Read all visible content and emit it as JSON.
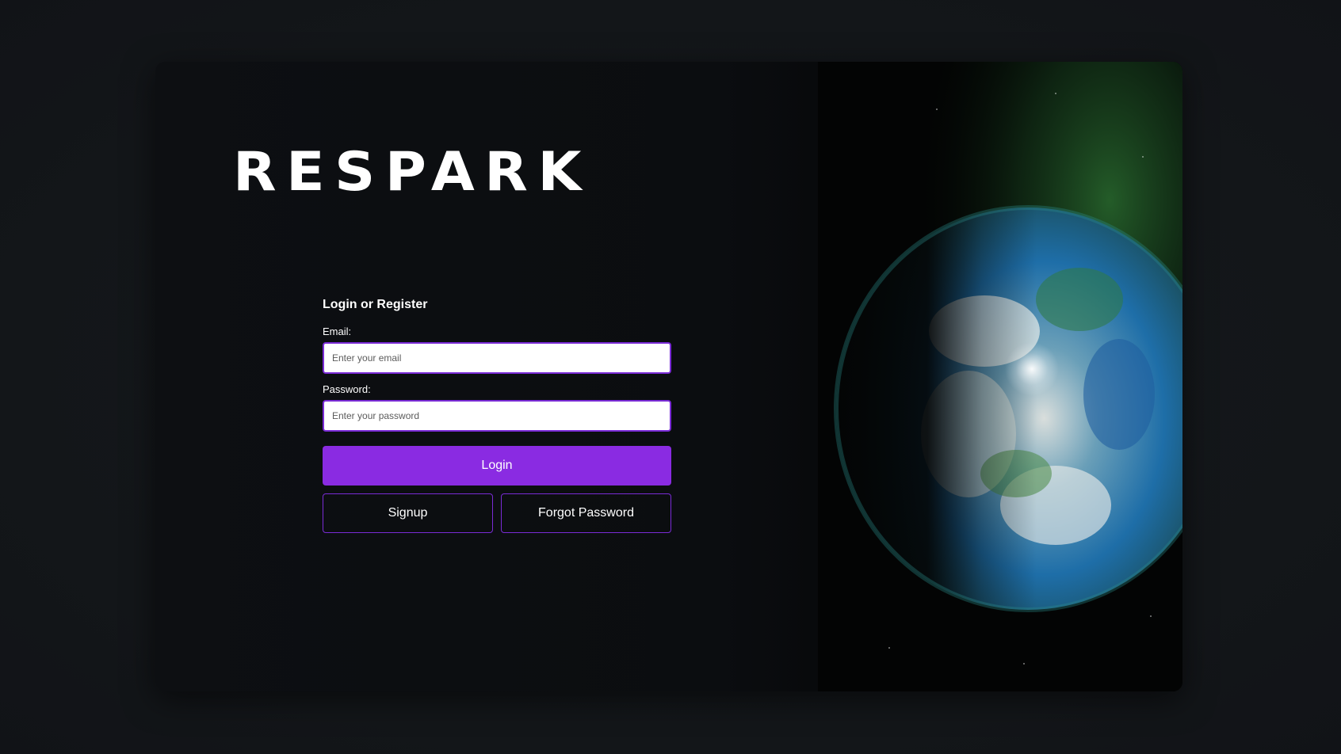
{
  "brand": {
    "logo_text": "RESPARK"
  },
  "form": {
    "title": "Login or Register",
    "email_label": "Email:",
    "email_placeholder": "Enter your email",
    "email_value": "",
    "password_label": "Password:",
    "password_placeholder": "Enter your password",
    "password_value": "",
    "login_label": "Login",
    "signup_label": "Signup",
    "forgot_label": "Forgot Password"
  },
  "colors": {
    "accent": "#8a2be2",
    "background": "#14171b",
    "card": "#0b0d10"
  },
  "icons": {
    "hero_image": "planet-illustration"
  }
}
